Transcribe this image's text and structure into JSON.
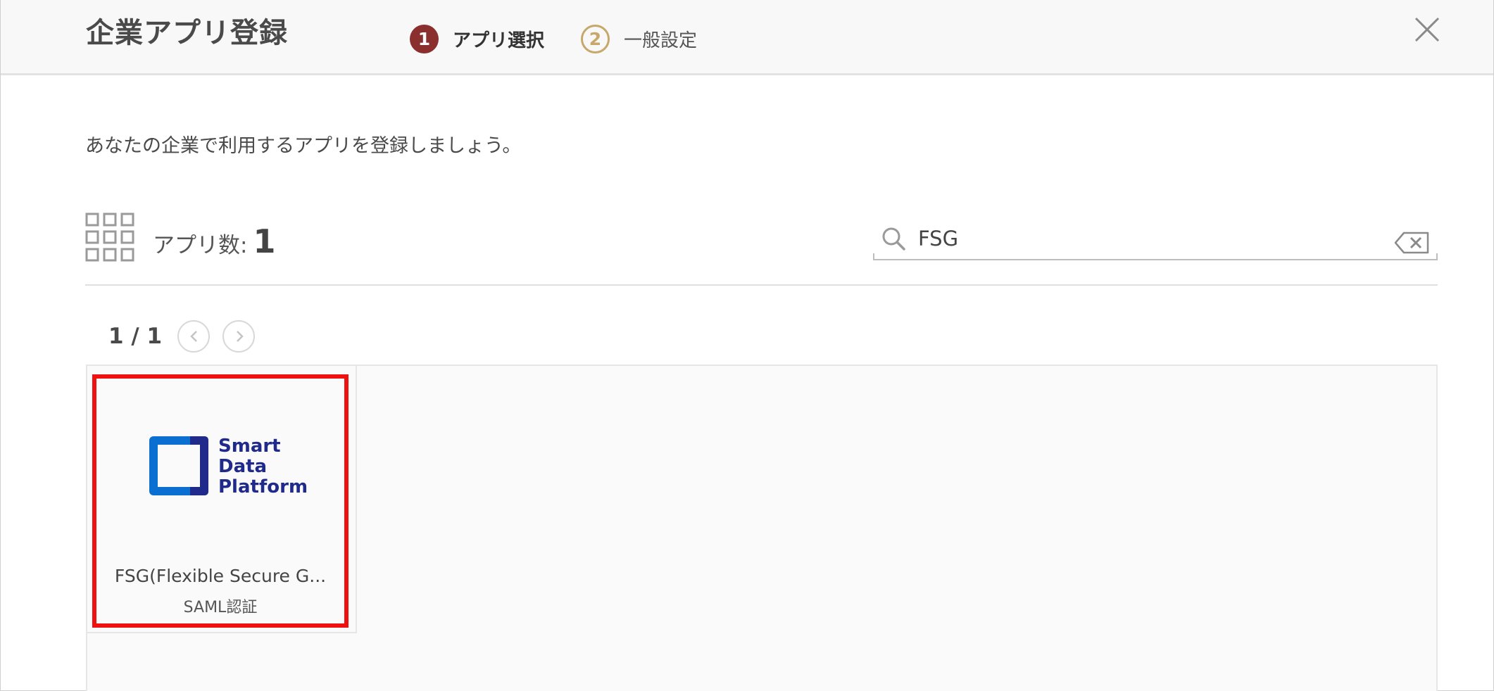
{
  "header": {
    "title": "企業アプリ登録",
    "steps": [
      {
        "number": "1",
        "label": "アプリ選択",
        "state": "active",
        "color": "#8b2e2e"
      },
      {
        "number": "2",
        "label": "一般設定",
        "state": "inactive",
        "color": "#c8a86a"
      }
    ],
    "close_icon": "close-icon"
  },
  "intro": "あなたの企業で利用するアプリを登録しましょう。",
  "summary": {
    "label": "アプリ数:",
    "count": "1",
    "icon": "grid-icon"
  },
  "search": {
    "value": "FSG",
    "icon": "search-icon",
    "clear_icon": "clear-input-icon"
  },
  "pagination": {
    "text": "1 / 1",
    "prev_icon": "chevron-left-icon",
    "next_icon": "chevron-right-icon"
  },
  "apps": [
    {
      "logo": {
        "lines": [
          "Smart",
          "Data",
          "Platform"
        ],
        "color": "#1f2a8a"
      },
      "name": "FSG(Flexible Secure G...",
      "auth": "SAML認証",
      "highlighted": true,
      "highlight_color": "#ee1111"
    }
  ]
}
